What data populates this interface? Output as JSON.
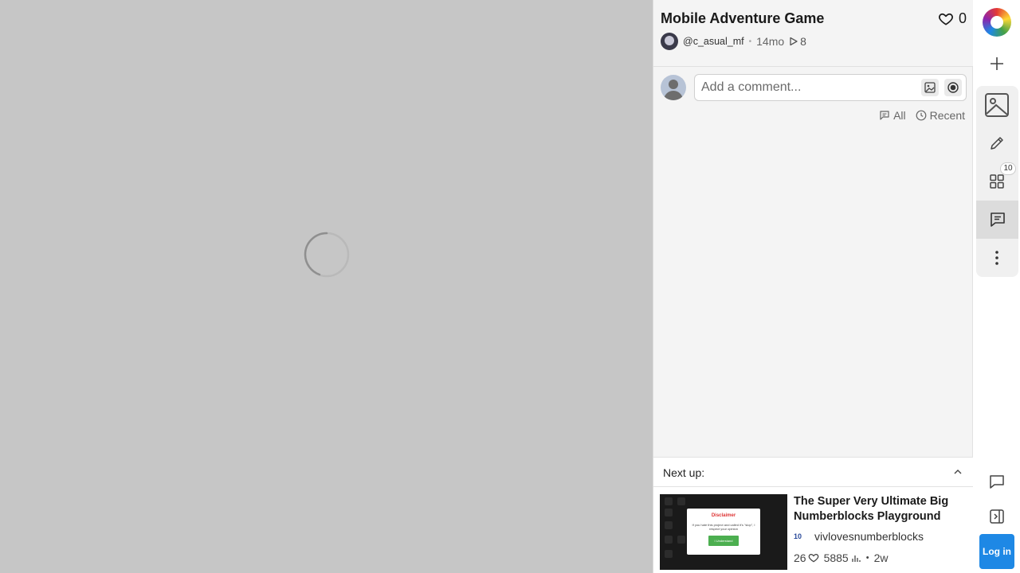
{
  "project": {
    "title": "Mobile Adventure Game",
    "likes": "0",
    "author": "@c_asual_mf",
    "age": "14mo",
    "runs": "8"
  },
  "comments": {
    "placeholder": "Add a comment...",
    "filter_all": "All",
    "filter_recent": "Recent"
  },
  "next_up": {
    "label": "Next up:",
    "title": "The Super Very Ultimate Big Numberblocks Playground",
    "author": "vivlovesnumberblocks",
    "author_badge": "10",
    "likes": "26",
    "views": "5885",
    "age": "2w",
    "thumbnail": {
      "heading": "Disclaimer",
      "text": "If you hate this project and called it's \"slop\", I respect your opinion",
      "button": "I Understand"
    }
  },
  "rail": {
    "assets_badge": "10",
    "login_label": "Log in"
  },
  "colors": {
    "game_bg": "#c6c6c6",
    "panel_bg": "#f4f4f4",
    "accent": "#1e88e5"
  }
}
